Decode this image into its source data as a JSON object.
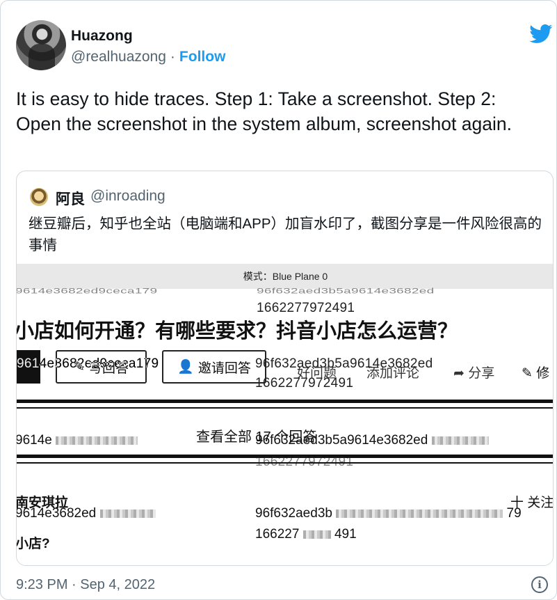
{
  "tweet": {
    "author_name": "Huazong",
    "author_handle": "@realhuazong",
    "separator": "·",
    "follow_label": "Follow",
    "text": "It is easy to hide traces. Step 1: Take a screenshot. Step 2: Open the screenshot in the system album, screenshot again.",
    "timestamp": "9:23 PM · Sep 4, 2022",
    "info_glyph": "i"
  },
  "quoted_tweet": {
    "author_name": "阿良",
    "author_handle": "@inroading",
    "text": "继豆瓣后，知乎也全站（电脑端和APP）加盲水印了，截图分享是一件风险很高的事情",
    "screenshot": {
      "mode_label": "模式：Blue Plane 0",
      "headline": "小店如何开通？有哪些要求？抖音小店怎么运营？",
      "watermark_hash_left": "9614e3682ed9ceca179",
      "watermark_hash_right": "96f632aed3b5a9614e3682ed",
      "watermark_timestamp": "1662277972491",
      "write_answer_label": "写回答",
      "invite_answer_label": "邀请回答",
      "good_question_label": "好问题",
      "add_comment_label": "添加评论",
      "share_label": "分享",
      "modify_label": "修",
      "view_all_label": "查看全部 17 个回答",
      "user_name": "南安琪拉",
      "follow_label": "关注",
      "follow_plus": "十",
      "bottom_line": "小店?",
      "hash_fragment_a": "9614e3682ed",
      "hash_fragment_b": "96f632aed3b",
      "hash_tail": "79",
      "ts_fragment": "166227",
      "ts_tail": "491",
      "hash_short": "9614e"
    }
  },
  "colors": {
    "accent": "#1d9bf0",
    "text_primary": "#0f1419",
    "text_secondary": "#536471",
    "border": "#cfd9de"
  }
}
